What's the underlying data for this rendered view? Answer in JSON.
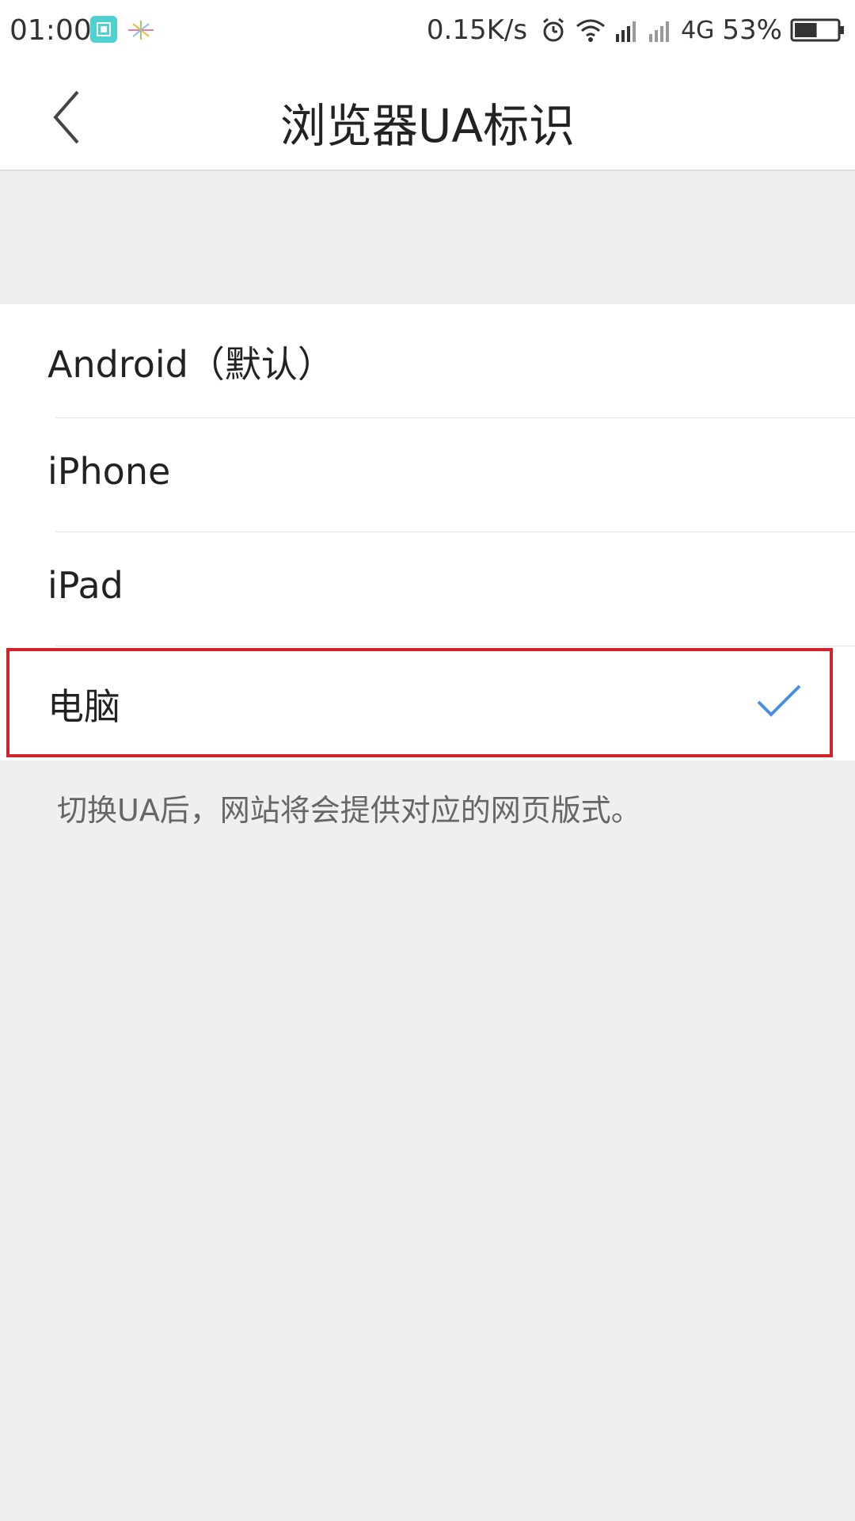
{
  "status_bar": {
    "time": "01:00",
    "speed": "0.15K/s",
    "network": "4G",
    "battery": "53%",
    "battery_level": 0.53,
    "icons": [
      "screen-capture-icon",
      "sparkle-icon",
      "alarm-icon",
      "wifi-icon",
      "signal-icon",
      "signal-icon",
      "battery-icon"
    ]
  },
  "nav": {
    "title": "浏览器UA标识",
    "back_icon": "chevron-left-icon"
  },
  "options": [
    {
      "label": "Android（默认）",
      "selected": false
    },
    {
      "label": "iPhone",
      "selected": false
    },
    {
      "label": "iPad",
      "selected": false
    },
    {
      "label": "电脑",
      "selected": true
    }
  ],
  "hint": "切换UA后，网站将会提供对应的网页版式。",
  "colors": {
    "check": "#4a90e2",
    "highlight": "#d2232a",
    "background": "#efefef"
  }
}
